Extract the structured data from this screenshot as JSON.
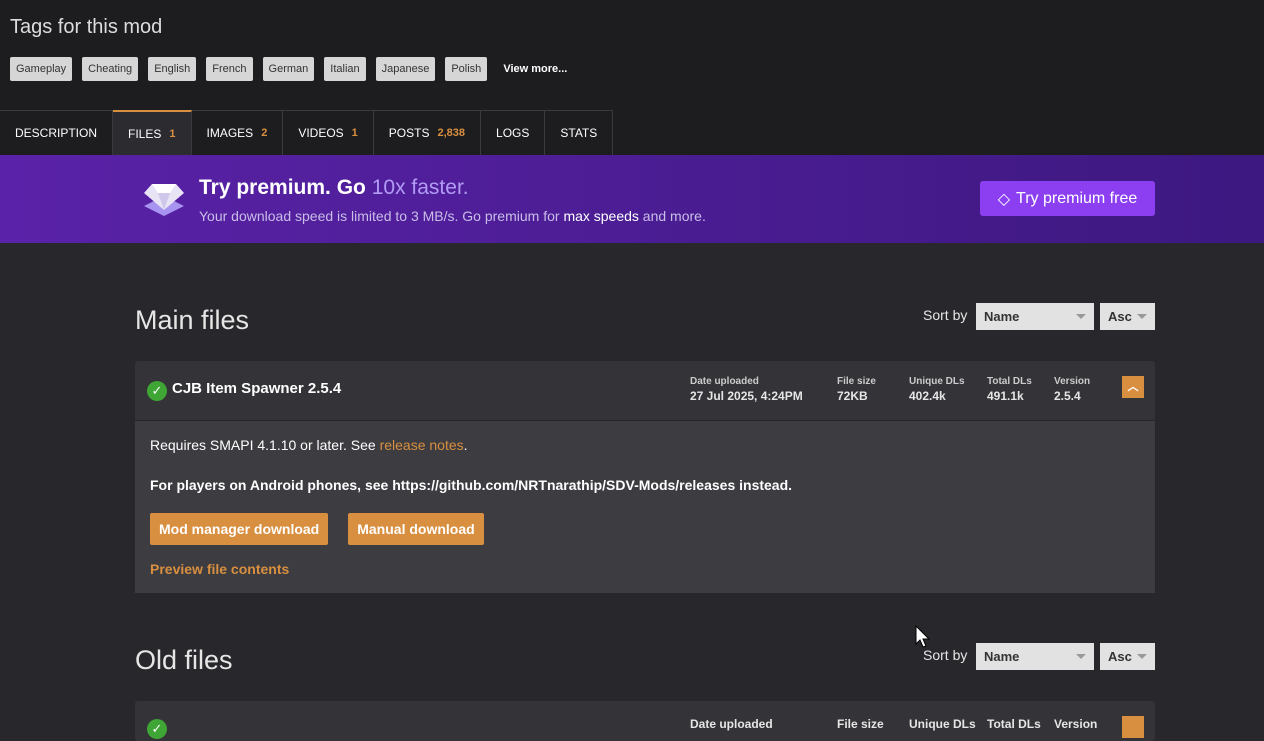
{
  "tags": {
    "title": "Tags for this mod",
    "items": [
      "Gameplay",
      "Cheating",
      "English",
      "French",
      "German",
      "Italian",
      "Japanese",
      "Polish"
    ],
    "view_more": "View more..."
  },
  "tabs": [
    {
      "label": "DESCRIPTION",
      "count": ""
    },
    {
      "label": "FILES",
      "count": "1"
    },
    {
      "label": "IMAGES",
      "count": "2"
    },
    {
      "label": "VIDEOS",
      "count": "1"
    },
    {
      "label": "POSTS",
      "count": "2,838"
    },
    {
      "label": "LOGS",
      "count": ""
    },
    {
      "label": "STATS",
      "count": ""
    }
  ],
  "promo": {
    "title": "Try premium. Go ",
    "title_hl": "10x faster.",
    "sub": "Your download speed is limited to 3 MB/s. Go premium for ",
    "sub_b": "max speeds",
    "sub_end": " and more.",
    "button": "Try premium free"
  },
  "main": {
    "heading": "Main files",
    "sort_label": "Sort by",
    "sort_field": "Name",
    "sort_order": "Asc",
    "file": {
      "title": "CJB Item Spawner 2.5.4",
      "date_label": "Date uploaded",
      "date": "27 Jul 2025, 4:24PM",
      "size_label": "File size",
      "size": "72KB",
      "unique_label": "Unique DLs",
      "unique": "402.4k",
      "total_label": "Total DLs",
      "total": "491.1k",
      "version_label": "Version",
      "version": "2.5.4",
      "req": "Requires SMAPI 4.1.10 or later. See ",
      "req_link": "release notes",
      "req_end": ".",
      "android": "For players on Android phones, see https://github.com/NRTnarathip/SDV-Mods/releases instead.",
      "mm_btn": "Mod manager download",
      "manual_btn": "Manual download",
      "preview": "Preview file contents"
    }
  },
  "old": {
    "heading": "Old files",
    "sort_label": "Sort by",
    "sort_field": "Name",
    "sort_order": "Asc",
    "date_label": "Date uploaded",
    "size_label": "File size",
    "unique_label": "Unique DLs",
    "total_label": "Total DLs",
    "version_label": "Version"
  },
  "colors": {
    "accent": "#d98f40",
    "premium": "#8b3ff0"
  }
}
